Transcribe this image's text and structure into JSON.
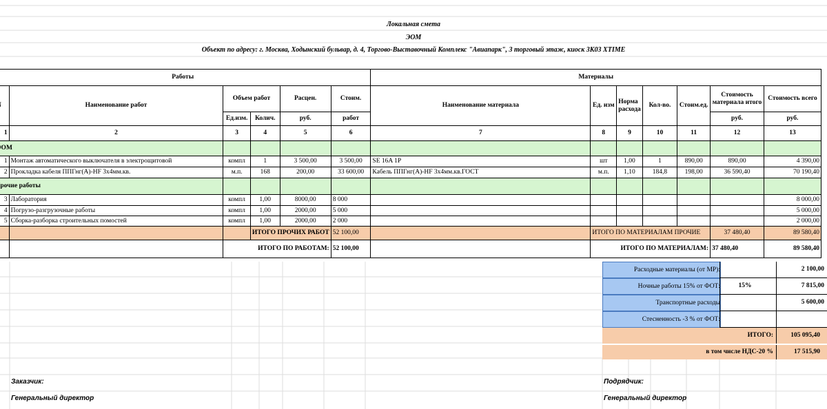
{
  "header": {
    "title": "Локальная смета",
    "subtitle": "ЭОМ",
    "object": "Объект по адресу: г. Москва, Ходынский бульвар, д. 4, Торгово-Выставочный Комплекс  \"Авиапарк\", 3 торговый этаж, киоск 3К03 XTIME"
  },
  "columns": {
    "works": "Работы",
    "materials": "Материалы",
    "n": "N",
    "work_name": "Наименование работ",
    "volume": "Объем работ",
    "unit": "Ед.изм.",
    "qty": "Колич.",
    "price": "Расцен.",
    "price_unit": "руб.",
    "cost": "Стоим.",
    "cost_unit": "работ",
    "mat_name": "Наименование материала",
    "mat_unit": "Ед. изм",
    "norm": "Норма расхода",
    "mat_qty": "Кол-во.",
    "mat_price": "Стоим.ед.",
    "mat_total": "Стоимость материала итого",
    "mat_total_unit": "руб.",
    "total_all": "Стоимость всего",
    "total_all_unit": "руб.",
    "nums": [
      "1",
      "2",
      "3",
      "4",
      "5",
      "6",
      "7",
      "8",
      "9",
      "10",
      "11",
      "12",
      "13"
    ]
  },
  "sections": {
    "eom": "ЭОМ",
    "other": "Прочие работы"
  },
  "rows": [
    {
      "n": "1",
      "name": "Монтаж автоматического выключателя в электрощитовой",
      "unit": "компл",
      "qty": "1",
      "price": "3 500,00",
      "cost": "3 500,00",
      "mat": "SE 16A 1P",
      "munit": "шт",
      "norm": "1,00",
      "mqty": "1",
      "mprice": "890,00",
      "mtotal": "890,00",
      "total": "4 390,00"
    },
    {
      "n": "2",
      "name": "Прокладка кабеля ППГнг(А)-HF 3х4мм.кв.",
      "unit": "м.п.",
      "qty": "168",
      "price": "200,00",
      "cost": "33 600,00",
      "mat": "Кабель ППГнг(А)-HF 3х4мм.кв.ГОСТ",
      "munit": "м.п.",
      "norm": "1,10",
      "mqty": "184,8",
      "mprice": "198,00",
      "mtotal": "36 590,40",
      "total": "70 190,40"
    },
    {
      "n": "3",
      "name": "Лаборатория",
      "unit": "компл",
      "qty": "1,00",
      "price": "8000,00",
      "cost": "8 000",
      "total": "8 000,00"
    },
    {
      "n": "4",
      "name": "Погрузо-разгрузочные работы",
      "unit": "компл",
      "qty": "1,00",
      "price": "2000,00",
      "cost": "5 000",
      "total": "5 000,00"
    },
    {
      "n": "5",
      "name": "Сборка-разборка строительных помостей",
      "unit": "компл",
      "qty": "1,00",
      "price": "2000,00",
      "cost": "2 000",
      "total": "2 000,00"
    }
  ],
  "totals": {
    "other_label": "ИТОГО ПРОЧИХ РАБОТ",
    "other_value": "52 100,00",
    "mat_other_label": "ИТОГО ПО МАТЕРИАЛАМ ПРОЧИЕ",
    "mat_other_value": "37 480,40",
    "mat_other_total": "89 580,40",
    "work_label": "ИТОГО ПО РАБОТАМ:",
    "work_value": "52 100,00",
    "mat_label": "ИТОГО ПО МАТЕРИАЛАМ:",
    "mat_value": "37 480,40",
    "mat_total": "89 580,40"
  },
  "extras": [
    {
      "label": "Расходные материалы (от МР):",
      "pct": "",
      "value": "2 100,00"
    },
    {
      "label": "Ночные работы 15% от ФОТ:",
      "pct": "15%",
      "value": "7 815,00"
    },
    {
      "label": "Транспортные расходы",
      "pct": "",
      "value": "5 600,00"
    },
    {
      "label": "Стесненность -3 % от ФОТ:",
      "pct": "",
      "value": ""
    }
  ],
  "grand": {
    "label": "ИТОГО:",
    "value": "105 095,40",
    "vat_label": "в том числе НДС-20 %",
    "vat_value": "17 515,90"
  },
  "signatures": {
    "customer": "Заказчик:",
    "customer_role": "Генеральный директор",
    "contractor": "Подрядчик:",
    "contractor_role": "Генеральный директор"
  }
}
